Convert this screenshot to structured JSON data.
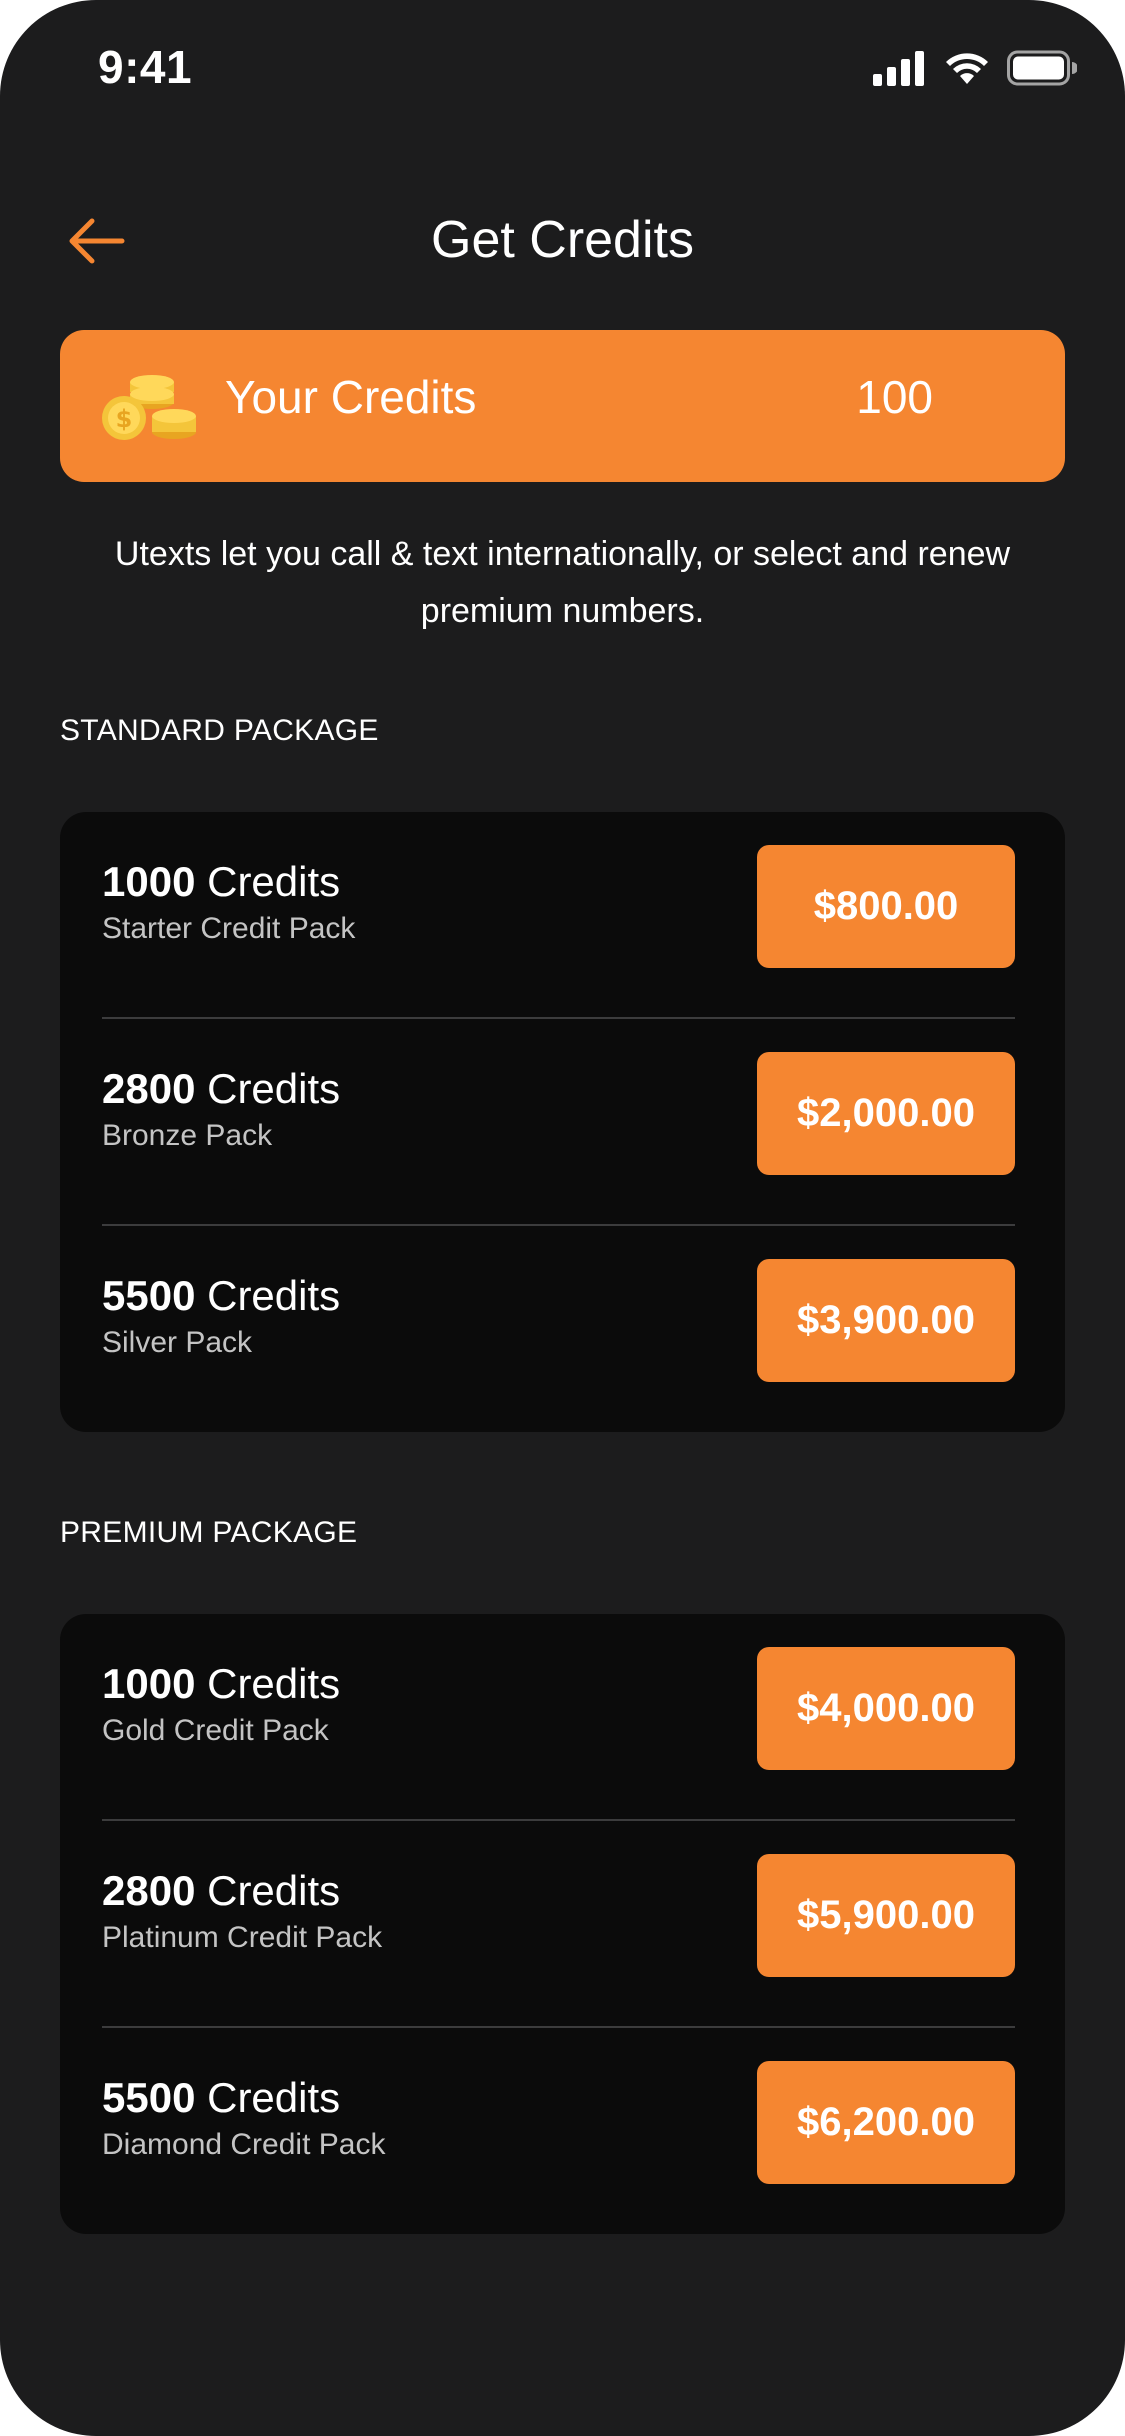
{
  "status_bar": {
    "time": "9:41"
  },
  "header": {
    "title": "Get Credits",
    "back_icon": "arrow-left-icon"
  },
  "credits": {
    "label": "Your Credits",
    "value": "100",
    "icon": "coins-icon"
  },
  "description": "Utexts let you call & text internationally, or select and renew premium numbers.",
  "standard": {
    "heading": "STANDARD PACKAGE",
    "packages": [
      {
        "amount": "1000",
        "unit": "Credits",
        "name": "Starter Credit Pack",
        "price": "$800.00"
      },
      {
        "amount": "2800",
        "unit": "Credits",
        "name": "Bronze Pack",
        "price": "$2,000.00"
      },
      {
        "amount": "5500",
        "unit": "Credits",
        "name": "Silver Pack",
        "price": "$3,900.00"
      }
    ]
  },
  "premium": {
    "heading": "PREMIUM PACKAGE",
    "packages": [
      {
        "amount": "1000",
        "unit": "Credits",
        "name": "Gold Credit Pack",
        "price": "$4,000.00"
      },
      {
        "amount": "2800",
        "unit": "Credits",
        "name": "Platinum Credit Pack",
        "price": "$5,900.00"
      },
      {
        "amount": "5500",
        "unit": "Credits",
        "name": "Diamond Credit Pack",
        "price": "$6,200.00"
      }
    ]
  },
  "colors": {
    "accent": "#F58631",
    "background": "#1C1C1D",
    "card": "#0B0B0B"
  }
}
